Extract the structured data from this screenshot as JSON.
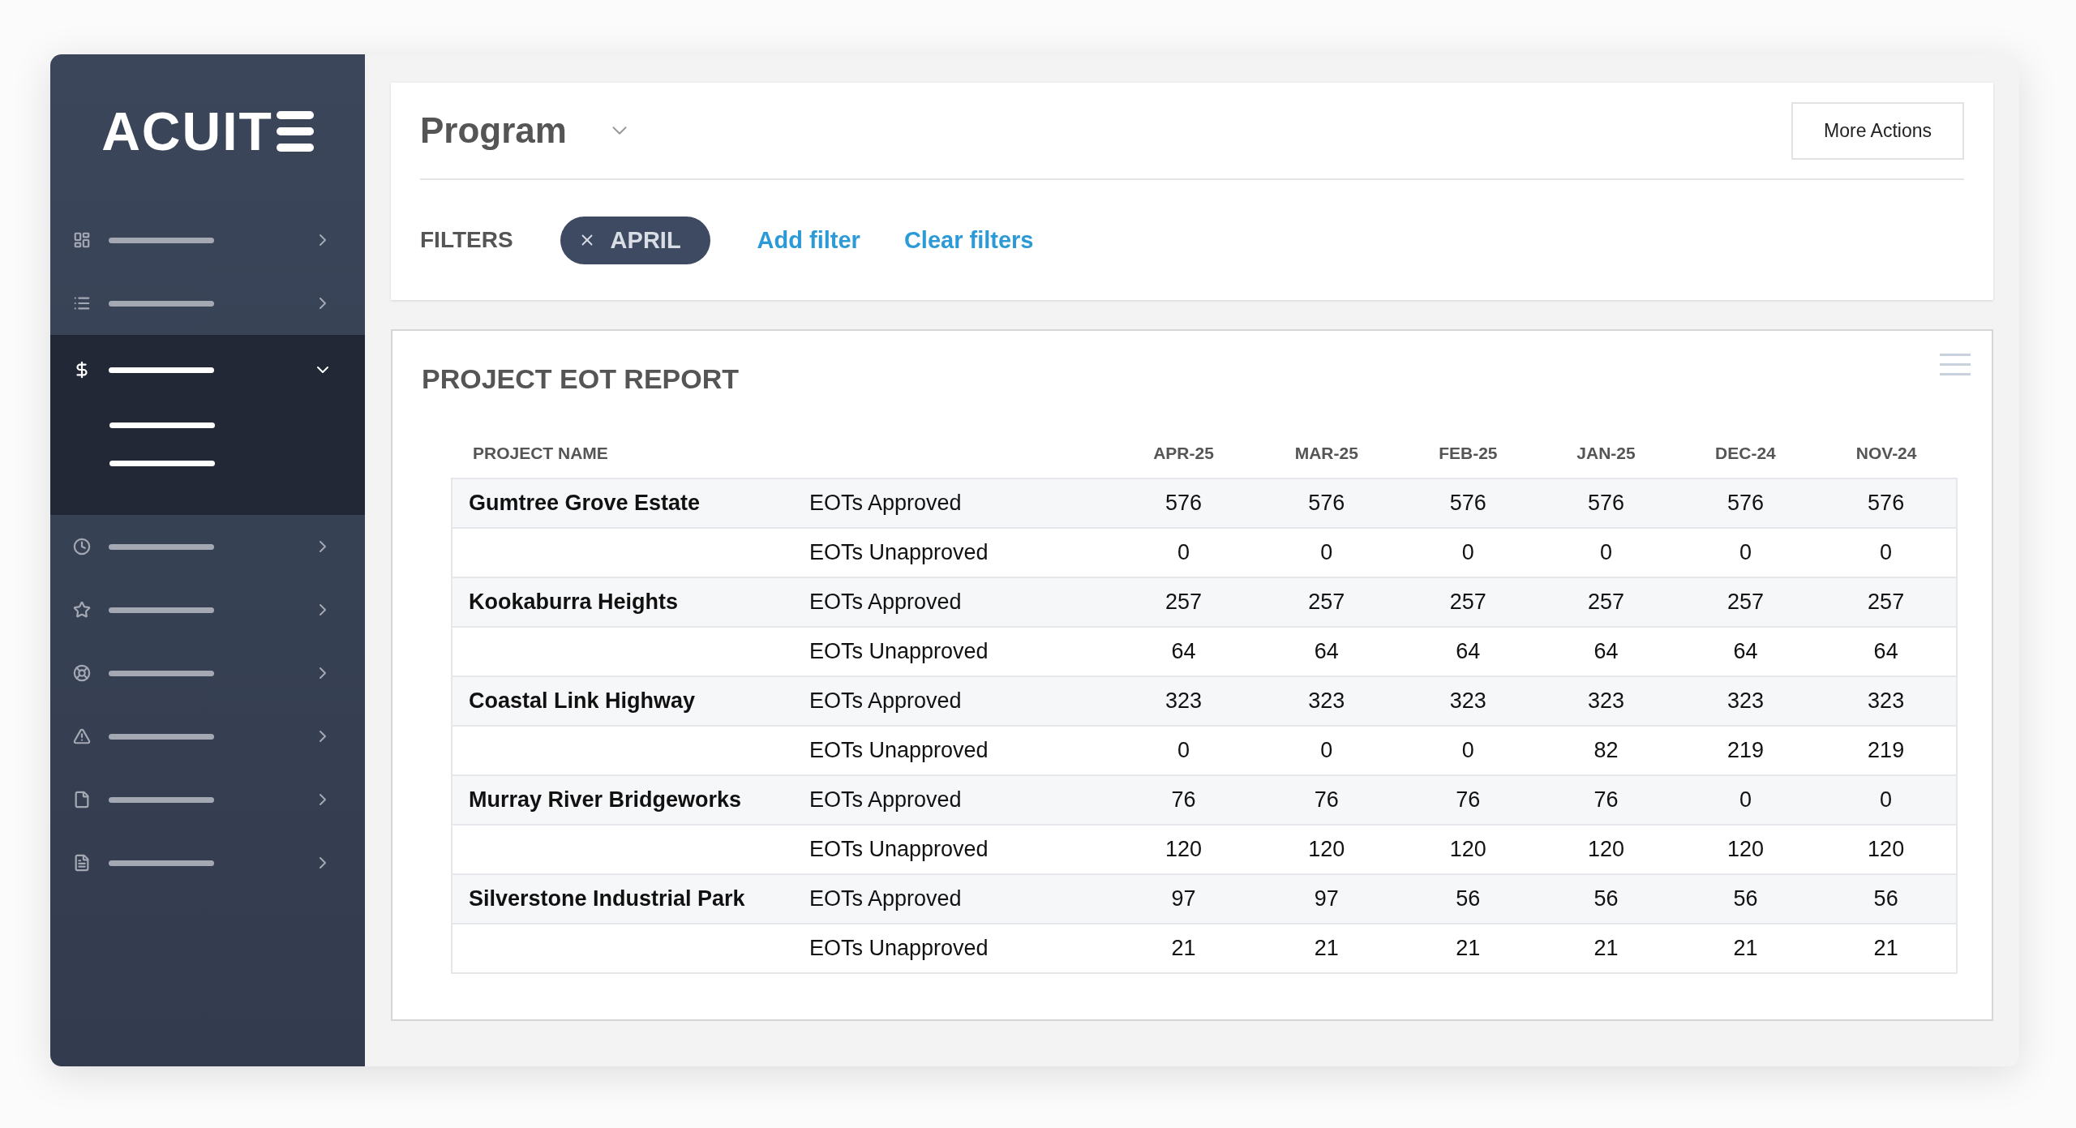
{
  "sidebar": {
    "logo": "ACUIT",
    "items": [
      {
        "kind": "dashboard",
        "selected": false,
        "expanded": false
      },
      {
        "kind": "list",
        "selected": false,
        "expanded": false
      },
      {
        "kind": "dollar",
        "selected": true,
        "expanded": true,
        "children": [
          {
            "kind": "line"
          },
          {
            "kind": "line"
          }
        ]
      },
      {
        "kind": "clock",
        "selected": false,
        "expanded": false
      },
      {
        "kind": "star",
        "selected": false,
        "expanded": false
      },
      {
        "kind": "lifebuoy",
        "selected": false,
        "expanded": false
      },
      {
        "kind": "warning",
        "selected": false,
        "expanded": false
      },
      {
        "kind": "file",
        "selected": false,
        "expanded": false
      },
      {
        "kind": "document",
        "selected": false,
        "expanded": false
      }
    ]
  },
  "header": {
    "title": "Program",
    "more_actions": "More Actions",
    "filters_label": "FILTERS",
    "filters": [
      {
        "label": "APRIL"
      }
    ],
    "add_filter": "Add filter",
    "clear_filters": "Clear filters"
  },
  "report": {
    "title": "PROJECT EOT REPORT",
    "columns": [
      "PROJECT NAME",
      "",
      "APR-25",
      "MAR-25",
      "FEB-25",
      "JAN-25",
      "DEC-24",
      "NOV-24"
    ],
    "rows": [
      {
        "project": "Gumtree Grove Estate",
        "metric": "EOTs Approved",
        "values": [
          "576",
          "576",
          "576",
          "576",
          "576",
          "576"
        ]
      },
      {
        "project": "",
        "metric": "EOTs Unapproved",
        "values": [
          "0",
          "0",
          "0",
          "0",
          "0",
          "0"
        ]
      },
      {
        "project": "Kookaburra Heights",
        "metric": "EOTs Approved",
        "values": [
          "257",
          "257",
          "257",
          "257",
          "257",
          "257"
        ]
      },
      {
        "project": "",
        "metric": "EOTs Unapproved",
        "values": [
          "64",
          "64",
          "64",
          "64",
          "64",
          "64"
        ]
      },
      {
        "project": "Coastal Link Highway",
        "metric": "EOTs Approved",
        "values": [
          "323",
          "323",
          "323",
          "323",
          "323",
          "323"
        ]
      },
      {
        "project": "",
        "metric": "EOTs Unapproved",
        "values": [
          "0",
          "0",
          "0",
          "82",
          "219",
          "219"
        ]
      },
      {
        "project": "Murray River Bridgeworks",
        "metric": "EOTs Approved",
        "values": [
          "76",
          "76",
          "76",
          "76",
          "0",
          "0"
        ]
      },
      {
        "project": "",
        "metric": "EOTs Unapproved",
        "values": [
          "120",
          "120",
          "120",
          "120",
          "120",
          "120"
        ]
      },
      {
        "project": "Silverstone Industrial Park",
        "metric": "EOTs Approved",
        "values": [
          "97",
          "97",
          "56",
          "56",
          "56",
          "56"
        ]
      },
      {
        "project": "",
        "metric": "EOTs Unapproved",
        "values": [
          "21",
          "21",
          "21",
          "21",
          "21",
          "21"
        ]
      }
    ]
  }
}
